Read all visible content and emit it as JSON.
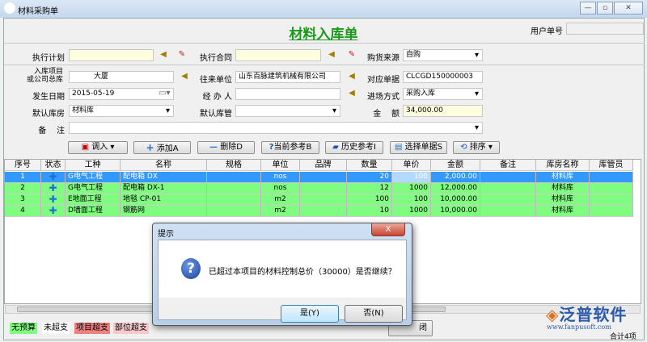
{
  "window": {
    "title": "材料采购单",
    "min": "—",
    "max": "▫",
    "close": "✕"
  },
  "form": {
    "title": "材料入库单",
    "user_no_label": "用户单号",
    "user_no": "",
    "exec_plan_label": "执行计划",
    "exec_plan": "",
    "exec_contract_label": "执行合同",
    "exec_contract": "",
    "source_label": "购货来源",
    "source": "自购",
    "project_label_1": "入库项目",
    "project_label_2": "或公司总库",
    "project": "大厦",
    "partner_label": "往来单位",
    "partner": "山东百脉建筑机械有限公司",
    "doc_label": "对应单据",
    "doc": "CLCGD150000003",
    "date_label": "发生日期",
    "date": "2015-05-19",
    "handler_label": "经 办 人",
    "handler": "",
    "entry_label": "进场方式",
    "entry": "采购入库",
    "warehouse_label": "默认库房",
    "warehouse": "材料库",
    "keeper_label": "默认库管",
    "keeper": "",
    "amount_label": "金    额",
    "amount": "34,000.00",
    "remark_label": "备    注",
    "remark": ""
  },
  "toolbar": {
    "import": "调入",
    "add": "添加A",
    "delete": "删除D",
    "current_ref": "当前参考B",
    "history_ref": "历史参考I",
    "select_doc": "选择单据S",
    "sort": "排序"
  },
  "table": {
    "headers": [
      "序号",
      "状态",
      "工种",
      "名称",
      "规格",
      "单位",
      "品牌",
      "数量",
      "单价",
      "金额",
      "备注",
      "库房名称",
      "库管员"
    ],
    "rows": [
      {
        "no": "1",
        "trade": "G电气工程",
        "name": "配电箱 DX",
        "spec": "",
        "unit": "nos",
        "brand": "",
        "qty": "20",
        "price": "100",
        "amount": "2,000.00",
        "remark": "",
        "wh": "材料库",
        "keeper": ""
      },
      {
        "no": "2",
        "trade": "G电气工程",
        "name": "配电箱 DX-1",
        "spec": "",
        "unit": "nos",
        "brand": "",
        "qty": "12",
        "price": "1000",
        "amount": "12,000.00",
        "remark": "",
        "wh": "材料库",
        "keeper": ""
      },
      {
        "no": "3",
        "trade": "E地面工程",
        "name": "地毯 CP-01",
        "spec": "",
        "unit": "m2",
        "brand": "",
        "qty": "100",
        "price": "100",
        "amount": "10,000.00",
        "remark": "",
        "wh": "材料库",
        "keeper": ""
      },
      {
        "no": "4",
        "trade": "D墙面工程",
        "name": "钢筋网",
        "spec": "",
        "unit": "m2",
        "brand": "",
        "qty": "10",
        "price": "1000",
        "amount": "10,000.00",
        "remark": "",
        "wh": "材料库",
        "keeper": ""
      }
    ]
  },
  "legend": {
    "no_budget": "无预算",
    "not_over": "未超支",
    "project_over": "项目超支",
    "part_over": "部位超支"
  },
  "footer": {
    "total": "合计4项",
    "close_btn": "闭"
  },
  "dialog": {
    "title": "提示",
    "message": "已超过本项目的材料控制总价（30000）是否继续？",
    "yes": "是(Y)",
    "no": "否(N)",
    "close": "X"
  },
  "logo": {
    "text": "泛普软件",
    "url": "www.fanpusoft.com"
  },
  "colors": {
    "accent_green": "#1a9a1a",
    "row_green": "#80fc80",
    "row_selected": "#3399ff"
  }
}
